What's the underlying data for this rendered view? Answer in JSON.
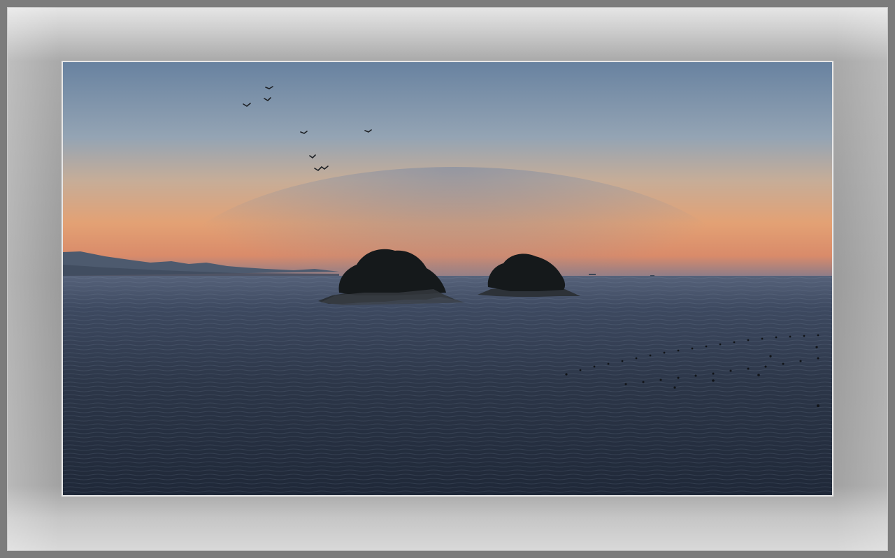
{
  "scene": {
    "subject": "two-islands-at-sunset",
    "birds": 7,
    "colors": {
      "frame_outer": "#7c7c7c",
      "frame_mat": "#9c9c9c",
      "sky_top": "#6b86a3",
      "sky_mid": "#b9a595",
      "horizon_glow": "#e99a6a",
      "sea": "#2a3444",
      "island": "#161a1c"
    }
  }
}
